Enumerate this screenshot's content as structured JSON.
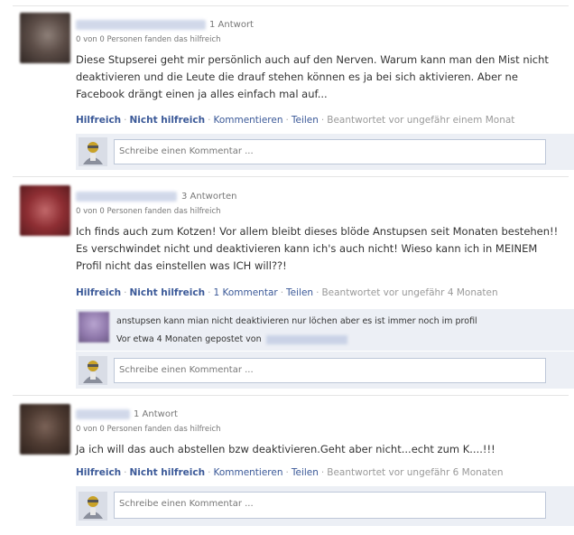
{
  "posts": [
    {
      "answers": "1 Antwort",
      "helpful": "0 von 0 Personen fanden das hilfreich",
      "text": "Diese Stupserei geht mir persönlich auch auf den Nerven. Warum kann man den Mist nicht deaktivieren und die Leute die drauf stehen können es ja bei sich aktivieren. Aber ne Facebook drängt einen ja alles einfach mal auf...",
      "actions": {
        "helpful": "Hilfreich",
        "not_helpful": "Nicht hilfreich",
        "comment": "Kommentieren",
        "share": "Teilen",
        "meta": "Beantwortet vor ungefähr einem Monat"
      },
      "comment_placeholder": "Schreibe einen Kommentar ..."
    },
    {
      "answers": "3 Antworten",
      "helpful": "0 von 0 Personen fanden das hilfreich",
      "text": "Ich finds auch zum Kotzen! Vor allem bleibt dieses blöde Anstupsen seit Monaten bestehen!! Es verschwindet nicht und deaktivieren kann ich's auch nicht! Wieso kann ich in MEINEM Profil nicht das einstellen was ICH will??!",
      "actions": {
        "helpful": "Hilfreich",
        "not_helpful": "Nicht hilfreich",
        "comment": "1 Kommentar",
        "share": "Teilen",
        "meta": "Beantwortet vor ungefähr 4 Monaten"
      },
      "reply": {
        "text": "anstupsen kann mian nicht deaktivieren nur löchen aber es ist immer noch im profil",
        "meta": "Vor etwa 4 Monaten gepostet von"
      },
      "comment_placeholder": "Schreibe einen Kommentar ..."
    },
    {
      "answers": "1 Antwort",
      "helpful": "0 von 0 Personen fanden das hilfreich",
      "text": "Ja ich will das auch abstellen bzw deaktivieren.Geht aber nicht...echt zum K....!!!",
      "actions": {
        "helpful": "Hilfreich",
        "not_helpful": "Nicht hilfreich",
        "comment": "Kommentieren",
        "share": "Teilen",
        "meta": "Beantwortet vor ungefähr 6 Monaten"
      },
      "comment_placeholder": "Schreibe einen Kommentar ..."
    }
  ],
  "colors": {
    "link": "#3b5998",
    "muted": "#999999",
    "box": "#eceff5",
    "border": "#bdc7d8"
  },
  "icons": {
    "commenter_avatar": "user-silhouette-icon"
  }
}
